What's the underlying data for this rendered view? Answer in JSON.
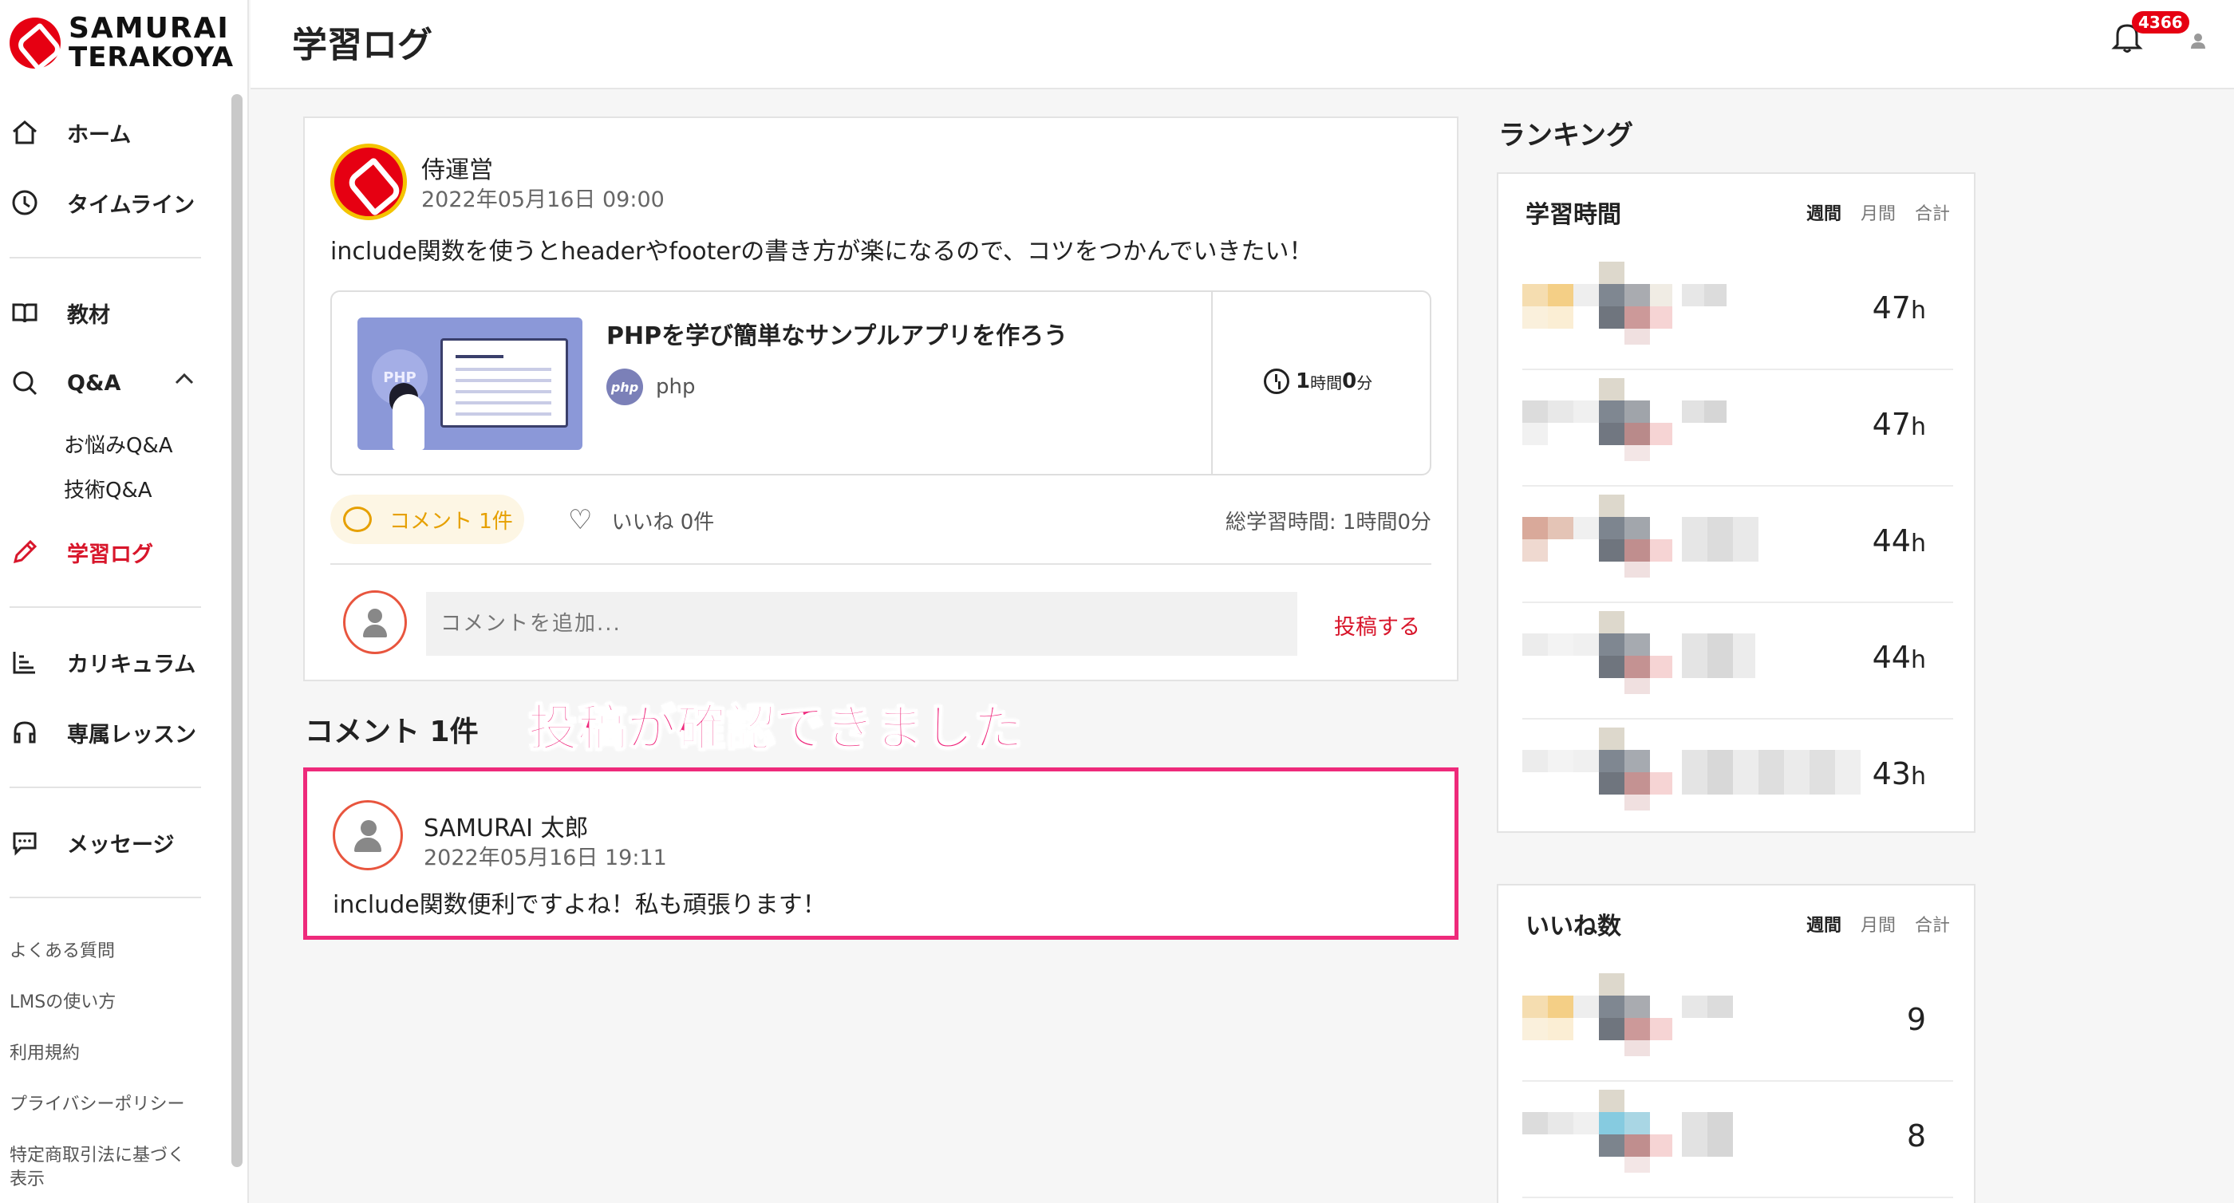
{
  "brand": {
    "line1": "SAMURAI",
    "line2": "TERAKOYA"
  },
  "header": {
    "title": "学習ログ",
    "notification_count": "4366"
  },
  "sidebar": {
    "items": [
      {
        "label": "ホーム",
        "icon": "home-icon"
      },
      {
        "label": "タイムライン",
        "icon": "clock-icon"
      },
      {
        "label": "教材",
        "icon": "book-icon"
      },
      {
        "label": "Q&A",
        "icon": "search-icon"
      },
      {
        "label": "学習ログ",
        "icon": "pencil-icon"
      },
      {
        "label": "カリキュラム",
        "icon": "curriculum-icon"
      },
      {
        "label": "専属レッスン",
        "icon": "headset-icon"
      },
      {
        "label": "メッセージ",
        "icon": "message-icon"
      }
    ],
    "qa_sub": [
      "お悩みQ&A",
      "技術Q&A"
    ],
    "footer_links": [
      "よくある質問",
      "LMSの使い方",
      "利用規約",
      "プライバシーポリシー",
      "特定商取引法に基づく表示"
    ]
  },
  "post": {
    "author": "侍運営",
    "date": "2022年05月16日 09:00",
    "body": "include関数を使うとheaderやfooterの書き方が楽になるので、コツをつかんでいきたい！",
    "course": {
      "title": "PHPを学び簡単なサンプルアプリを作ろう",
      "thumb_label": "PHP",
      "tag_icon_label": "php",
      "tag": "php",
      "time_hours": "1",
      "time_hours_unit": "時間",
      "time_minutes": "0",
      "time_minutes_unit": "分"
    },
    "comment_label": "コメント 1件",
    "like_label": "いいね 0件",
    "total_time": "総学習時間: 1時間0分",
    "comment_placeholder": "コメントを追加...",
    "submit_label": "投稿する"
  },
  "comments": {
    "heading": "コメント 1件",
    "annotation": "投稿が確認できました",
    "items": [
      {
        "author": "SAMURAI 太郎",
        "date": "2022年05月16日 19:11",
        "body": "include関数便利ですよね！私も頑張ります！"
      }
    ]
  },
  "ranking": {
    "heading": "ランキング",
    "study_time": {
      "title": "学習時間",
      "tabs": [
        "週間",
        "月間",
        "合計"
      ],
      "rows": [
        {
          "value": "47",
          "unit": "h"
        },
        {
          "value": "47",
          "unit": "h"
        },
        {
          "value": "44",
          "unit": "h"
        },
        {
          "value": "44",
          "unit": "h"
        },
        {
          "value": "43",
          "unit": "h"
        }
      ]
    },
    "likes": {
      "title": "いいね数",
      "tabs": [
        "週間",
        "月間",
        "合計"
      ],
      "rows": [
        {
          "value": "9"
        },
        {
          "value": "8"
        }
      ]
    }
  },
  "colors": {
    "brand_red": "#e60012",
    "accent_pink": "#ee2a7b",
    "active_red": "#d8162b",
    "comment_yellow": "#e6a000"
  }
}
